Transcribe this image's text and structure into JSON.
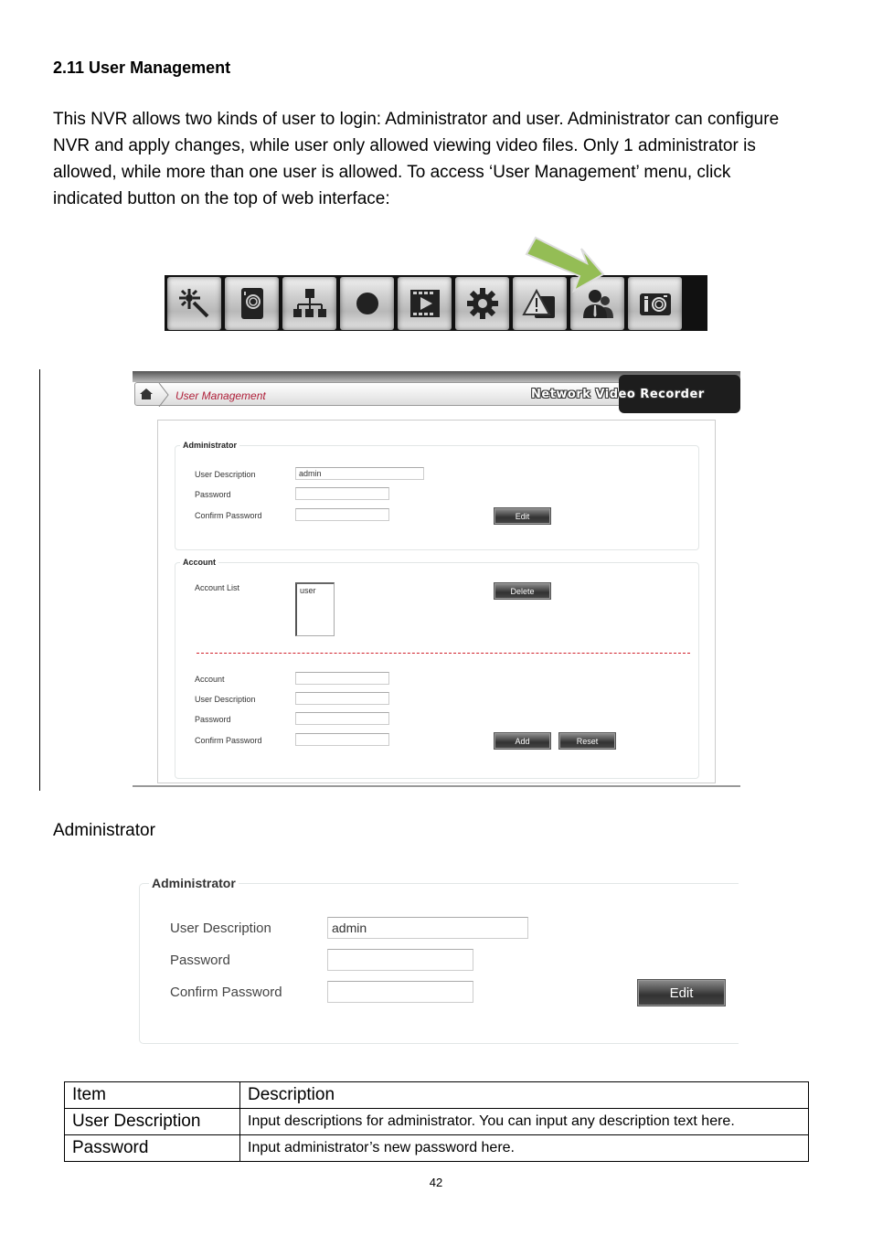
{
  "heading": "2.11 User Management",
  "intro_paragraph": "This NVR allows two kinds of user to login: Administrator and user. Administrator can configure NVR and apply changes, while user only allowed viewing video files. Only 1 administrator is allowed, while more than one user is allowed. To access ‘User Management’ menu, click indicated button on the top of web interface:",
  "toolbar": {
    "buttons": [
      {
        "icon": "wizard-wand-icon"
      },
      {
        "icon": "camera-icon"
      },
      {
        "icon": "network-icon"
      },
      {
        "icon": "record-icon"
      },
      {
        "icon": "playback-icon"
      },
      {
        "icon": "settings-gear-icon"
      },
      {
        "icon": "alarm-warning-icon"
      },
      {
        "icon": "user-management-icon"
      },
      {
        "icon": "snapshot-info-icon"
      }
    ],
    "highlighted_index": 7,
    "arrow_color": "#94bd55"
  },
  "screenshot": {
    "breadcrumb_title": "User Management",
    "brand": "Network Video Recorder",
    "administrator": {
      "legend": "Administrator",
      "user_description_label": "User Description",
      "user_description_value": "admin",
      "password_label": "Password",
      "password_value": "",
      "confirm_password_label": "Confirm Password",
      "confirm_password_value": "",
      "edit_button": "Edit"
    },
    "account": {
      "legend": "Account",
      "account_list_label": "Account List",
      "account_list_items": [
        "user"
      ],
      "delete_button": "Delete",
      "account_label": "Account",
      "user_description_label": "User Description",
      "password_label": "Password",
      "confirm_password_label": "Confirm Password",
      "add_button": "Add",
      "reset_button": "Reset"
    }
  },
  "section_label": "Administrator",
  "zoomed": {
    "legend": "Administrator",
    "user_description_label": "User Description",
    "user_description_value": "admin",
    "password_label": "Password",
    "confirm_password_label": "Confirm Password",
    "edit_button": "Edit"
  },
  "table": {
    "headers": [
      "Item",
      "Description"
    ],
    "rows": [
      {
        "item": "User Description",
        "description": "Input descriptions for administrator. You can input any description text here."
      },
      {
        "item": "Password",
        "description": "Input administrator’s new password here."
      }
    ]
  },
  "page_number": "42"
}
